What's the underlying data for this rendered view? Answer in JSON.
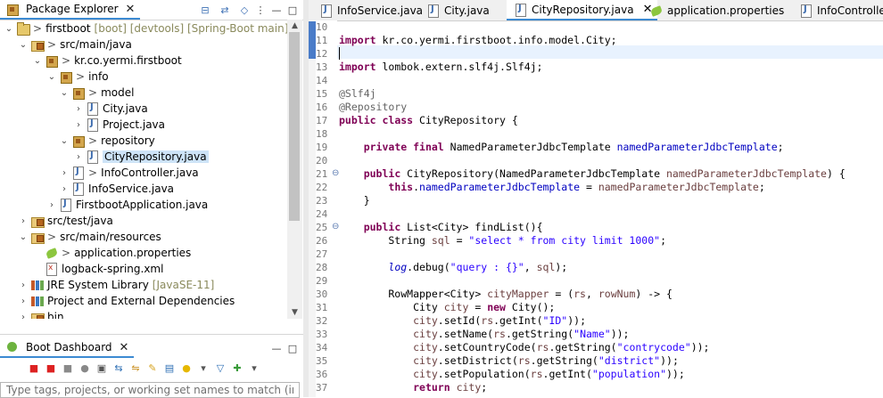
{
  "explorer": {
    "tab_label": "Package Explorer",
    "tree": [
      {
        "label": "firstboot",
        "decoration": "[boot] [devtools] [Spring-Boot main]",
        "icon": "project-icon"
      },
      {
        "label": "src/main/java",
        "prefix": ">",
        "icon": "source-folder-icon"
      },
      {
        "label": "kr.co.yermi.firstboot",
        "prefix": ">",
        "icon": "package-icon"
      },
      {
        "label": "info",
        "prefix": ">",
        "icon": "package-icon"
      },
      {
        "label": "model",
        "prefix": ">",
        "icon": "package-icon"
      },
      {
        "label": "City.java",
        "prefix": ">",
        "icon": "java-file-icon"
      },
      {
        "label": "Project.java",
        "prefix": ">",
        "icon": "java-file-icon"
      },
      {
        "label": "repository",
        "prefix": ">",
        "icon": "package-icon"
      },
      {
        "label": "CityRepository.java",
        "prefix": ">",
        "icon": "java-file-icon"
      },
      {
        "label": "InfoController.java",
        "prefix": ">",
        "icon": "java-file-icon"
      },
      {
        "label": "InfoService.java",
        "icon": "java-file-icon"
      },
      {
        "label": "FirstbootApplication.java",
        "icon": "java-file-icon"
      },
      {
        "label": "src/test/java",
        "icon": "source-folder-icon"
      },
      {
        "label": "src/main/resources",
        "prefix": ">",
        "icon": "source-folder-icon"
      },
      {
        "label": "application.properties",
        "prefix": ">",
        "icon": "properties-file-icon"
      },
      {
        "label": "logback-spring.xml",
        "icon": "xml-file-icon"
      },
      {
        "label": "JRE System Library",
        "decoration": "[JavaSE-11]",
        "icon": "library-icon"
      },
      {
        "label": "Project and External Dependencies",
        "icon": "library-icon"
      },
      {
        "label": "bin",
        "icon": "folder-icon"
      }
    ]
  },
  "dashboard": {
    "tab_label": "Boot Dashboard",
    "filter_placeholder": "Type tags, projects, or working set names to match (incl. * a"
  },
  "editor": {
    "tabs": [
      {
        "label": "InfoService.java",
        "icon": "java-file-icon"
      },
      {
        "label": "City.java",
        "icon": "java-file-icon"
      },
      {
        "label": "CityRepository.java",
        "icon": "java-file-icon",
        "active": true
      },
      {
        "label": "application.properties",
        "icon": "properties-file-icon"
      },
      {
        "label": "InfoController.java",
        "icon": "java-file-icon"
      }
    ],
    "line_numbers": [
      "10",
      "11",
      "12",
      "13",
      "14",
      "15",
      "16",
      "17",
      "18",
      "19",
      "20",
      "21",
      "22",
      "23",
      "24",
      "25",
      "26",
      "27",
      "28",
      "29",
      "30",
      "31",
      "32",
      "33",
      "34",
      "35",
      "36",
      "37"
    ]
  },
  "colors": {
    "keyword": "#7f0055",
    "string": "#2a00ff",
    "annotation": "#646464",
    "field": "#0000c0",
    "selection": "#cde3f7",
    "active_tab_accent": "#3c8ad2"
  }
}
